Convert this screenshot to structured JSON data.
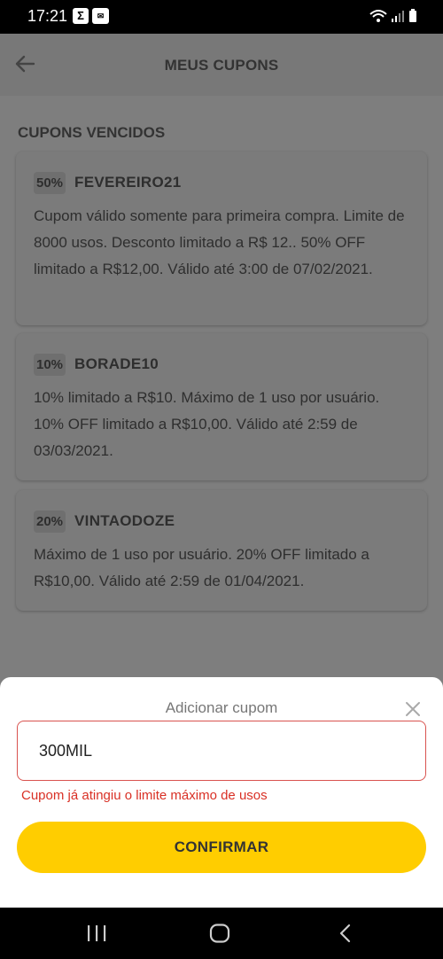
{
  "status_bar": {
    "time": "17:21",
    "icons": [
      "sigma-notification-icon",
      "message-notification-icon",
      "wifi-icon",
      "signal-icon",
      "battery-icon"
    ]
  },
  "header": {
    "title": "MEUS CUPONS",
    "back_icon": "arrow-left-icon"
  },
  "section": {
    "title": "CUPONS VENCIDOS"
  },
  "coupons": [
    {
      "badge": "50%",
      "code": "FEVEREIRO21",
      "description": "Cupom válido somente para primeira compra. Limite de 8000 usos. Desconto limitado a R$ 12.. 50% OFF limitado a R$12,00. Válido até 3:00 de 07/02/2021."
    },
    {
      "badge": "10%",
      "code": "BORADE10",
      "description": "10% limitado a R$10. Máximo de 1 uso por usuário. 10% OFF limitado a R$10,00. Válido até 2:59 de 03/03/2021."
    },
    {
      "badge": "20%",
      "code": "VINTAODOZE",
      "description": "Máximo de 1 uso por usuário. 20% OFF limitado a R$10,00. Válido até 2:59 de 01/04/2021."
    }
  ],
  "sheet": {
    "title": "Adicionar cupom",
    "input_value": "300MIL",
    "error": "Cupom já atingiu o limite máximo de usos",
    "confirm_label": "CONFIRMAR"
  },
  "colors": {
    "accent": "#ffcd00",
    "error": "#d93025",
    "overlay": "#7e7e7e"
  }
}
